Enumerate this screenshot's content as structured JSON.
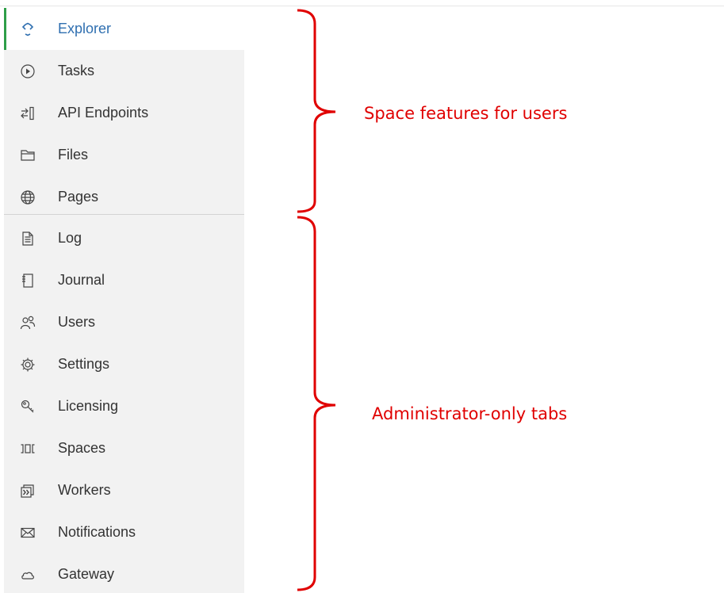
{
  "sidebar": {
    "items": [
      {
        "label": "Explorer",
        "icon": "explorer-icon",
        "active": true
      },
      {
        "label": "Tasks",
        "icon": "play-circle-icon"
      },
      {
        "label": "API Endpoints",
        "icon": "api-endpoints-icon"
      },
      {
        "label": "Files",
        "icon": "folder-icon"
      },
      {
        "label": "Pages",
        "icon": "globe-icon"
      },
      {
        "label": "Log",
        "icon": "log-document-icon"
      },
      {
        "label": "Journal",
        "icon": "journal-icon"
      },
      {
        "label": "Users",
        "icon": "users-icon"
      },
      {
        "label": "Settings",
        "icon": "gear-icon"
      },
      {
        "label": "Licensing",
        "icon": "key-icon"
      },
      {
        "label": "Spaces",
        "icon": "spaces-icon"
      },
      {
        "label": "Workers",
        "icon": "workers-icon"
      },
      {
        "label": "Notifications",
        "icon": "envelope-icon"
      },
      {
        "label": "Gateway",
        "icon": "cloud-icon"
      }
    ]
  },
  "annotations": {
    "user_features": "Space features for users",
    "admin_tabs": "Administrator-only tabs"
  },
  "colors": {
    "sidebar_background": "#f2f2f2",
    "active_accent": "#2e9e48",
    "active_label": "#2f6fb0",
    "annotation": "#e00000"
  }
}
